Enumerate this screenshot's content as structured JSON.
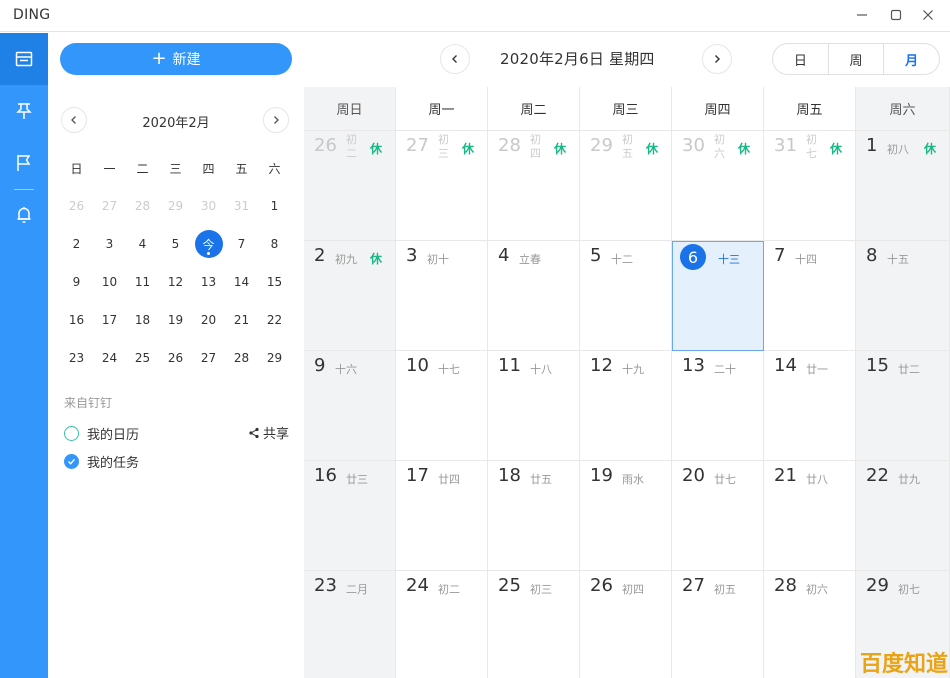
{
  "window": {
    "title": "DING",
    "minimize": "—",
    "maximize": "☐",
    "close": "✕"
  },
  "toolbar": {
    "new_label": "新建",
    "new_icon": "+"
  },
  "mini_calendar": {
    "title": "2020年2月",
    "weekdays": [
      "日",
      "一",
      "二",
      "三",
      "四",
      "五",
      "六"
    ],
    "weeks": [
      [
        {
          "t": "26",
          "out": true
        },
        {
          "t": "27",
          "out": true
        },
        {
          "t": "28",
          "out": true
        },
        {
          "t": "29",
          "out": true
        },
        {
          "t": "30",
          "out": true
        },
        {
          "t": "31",
          "out": true
        },
        {
          "t": "1"
        }
      ],
      [
        {
          "t": "2"
        },
        {
          "t": "3"
        },
        {
          "t": "4"
        },
        {
          "t": "5"
        },
        {
          "t": "今",
          "today": true
        },
        {
          "t": "7"
        },
        {
          "t": "8"
        }
      ],
      [
        {
          "t": "9"
        },
        {
          "t": "10"
        },
        {
          "t": "11"
        },
        {
          "t": "12"
        },
        {
          "t": "13"
        },
        {
          "t": "14"
        },
        {
          "t": "15"
        }
      ],
      [
        {
          "t": "16"
        },
        {
          "t": "17"
        },
        {
          "t": "18"
        },
        {
          "t": "19"
        },
        {
          "t": "20"
        },
        {
          "t": "21"
        },
        {
          "t": "22"
        }
      ],
      [
        {
          "t": "23"
        },
        {
          "t": "24"
        },
        {
          "t": "25"
        },
        {
          "t": "26"
        },
        {
          "t": "27"
        },
        {
          "t": "28"
        },
        {
          "t": "29"
        }
      ]
    ]
  },
  "sources": {
    "label": "来自钉钉",
    "calendars": [
      {
        "name": "我的日历",
        "checked": false
      },
      {
        "name": "我的任务",
        "checked": true
      }
    ],
    "share_label": "共享"
  },
  "header": {
    "date": "2020年2月6日 星期四"
  },
  "views": [
    {
      "label": "日",
      "active": false
    },
    {
      "label": "周",
      "active": false
    },
    {
      "label": "月",
      "active": true
    }
  ],
  "month": {
    "weekdays": [
      "周日",
      "周一",
      "周二",
      "周三",
      "周四",
      "周五",
      "周六"
    ],
    "weeks": [
      [
        {
          "d": "26",
          "l": "初二",
          "out": true,
          "h": "休"
        },
        {
          "d": "27",
          "l": "初三",
          "out": true,
          "h": "休"
        },
        {
          "d": "28",
          "l": "初四",
          "out": true,
          "h": "休"
        },
        {
          "d": "29",
          "l": "初五",
          "out": true,
          "h": "休"
        },
        {
          "d": "30",
          "l": "初六",
          "out": true,
          "h": "休"
        },
        {
          "d": "31",
          "l": "初七",
          "out": true,
          "h": "休"
        },
        {
          "d": "1",
          "l": "初八",
          "h": "休"
        }
      ],
      [
        {
          "d": "2",
          "l": "初九",
          "h": "休"
        },
        {
          "d": "3",
          "l": "初十"
        },
        {
          "d": "4",
          "l": "立春"
        },
        {
          "d": "5",
          "l": "十二"
        },
        {
          "d": "6",
          "l": "十三",
          "selected": true
        },
        {
          "d": "7",
          "l": "十四"
        },
        {
          "d": "8",
          "l": "十五"
        }
      ],
      [
        {
          "d": "9",
          "l": "十六"
        },
        {
          "d": "10",
          "l": "十七"
        },
        {
          "d": "11",
          "l": "十八"
        },
        {
          "d": "12",
          "l": "十九"
        },
        {
          "d": "13",
          "l": "二十"
        },
        {
          "d": "14",
          "l": "廿一"
        },
        {
          "d": "15",
          "l": "廿二"
        }
      ],
      [
        {
          "d": "16",
          "l": "廿三"
        },
        {
          "d": "17",
          "l": "廿四"
        },
        {
          "d": "18",
          "l": "廿五"
        },
        {
          "d": "19",
          "l": "雨水"
        },
        {
          "d": "20",
          "l": "廿七"
        },
        {
          "d": "21",
          "l": "廿八"
        },
        {
          "d": "22",
          "l": "廿九"
        }
      ],
      [
        {
          "d": "23",
          "l": "二月"
        },
        {
          "d": "24",
          "l": "初二"
        },
        {
          "d": "25",
          "l": "初三"
        },
        {
          "d": "26",
          "l": "初四"
        },
        {
          "d": "27",
          "l": "初五"
        },
        {
          "d": "28",
          "l": "初六"
        },
        {
          "d": "29",
          "l": "初七"
        }
      ]
    ]
  },
  "watermark": "百度知道",
  "colors": {
    "accent": "#3296fa",
    "holiday": "#19b886",
    "today": "#1a73e8",
    "weekend_bg": "#f2f3f4"
  }
}
